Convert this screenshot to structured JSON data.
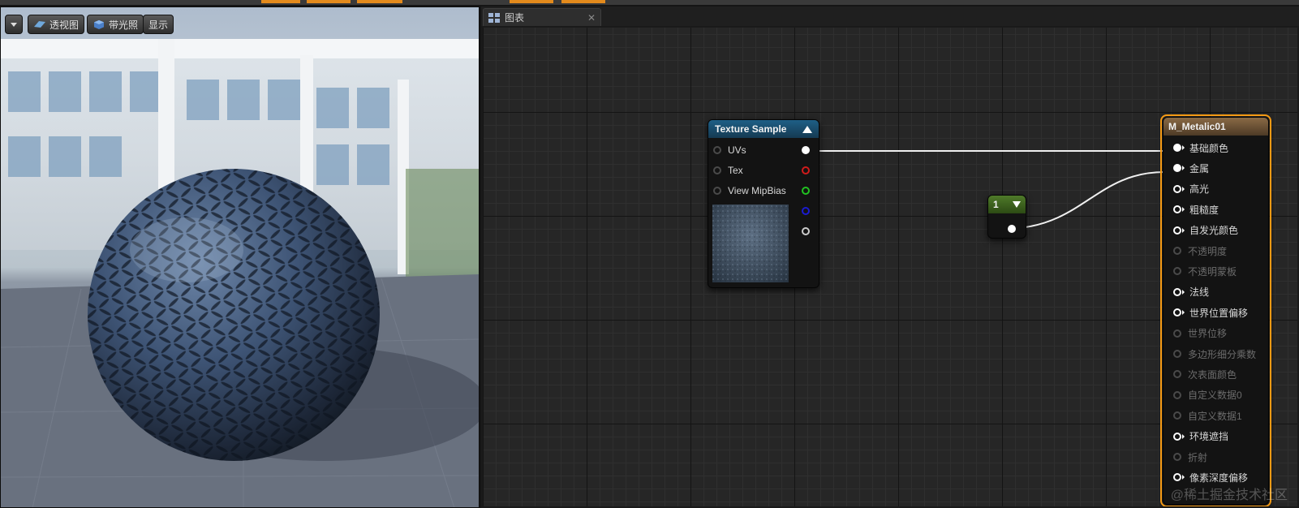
{
  "viewport": {
    "toolbar": {
      "perspective_label": "透视图",
      "lighting_label": "带光照",
      "show_label": "显示"
    }
  },
  "graph": {
    "tab_label": "图表",
    "texture_sample": {
      "title": "Texture Sample",
      "inputs": [
        "UVs",
        "Tex",
        "View MipBias"
      ],
      "output_colors": [
        "#ffffff",
        "#d11b1b",
        "#21c221",
        "#1b1bd1",
        "#cccccc"
      ]
    },
    "constant": {
      "value": "1"
    },
    "material": {
      "title": "M_Metalic01",
      "inputs": [
        {
          "label": "基础颜色",
          "state": "connected"
        },
        {
          "label": "金属",
          "state": "connected"
        },
        {
          "label": "高光",
          "state": "active"
        },
        {
          "label": "粗糙度",
          "state": "active"
        },
        {
          "label": "自发光颜色",
          "state": "active"
        },
        {
          "label": "不透明度",
          "state": "disabled"
        },
        {
          "label": "不透明蒙板",
          "state": "disabled"
        },
        {
          "label": "法线",
          "state": "active"
        },
        {
          "label": "世界位置偏移",
          "state": "active"
        },
        {
          "label": "世界位移",
          "state": "disabled"
        },
        {
          "label": "多边形细分乘数",
          "state": "disabled"
        },
        {
          "label": "次表面颜色",
          "state": "disabled"
        },
        {
          "label": "自定义数据0",
          "state": "disabled"
        },
        {
          "label": "自定义数据1",
          "state": "disabled"
        },
        {
          "label": "环境遮挡",
          "state": "active"
        },
        {
          "label": "折射",
          "state": "disabled"
        },
        {
          "label": "像素深度偏移",
          "state": "active"
        }
      ]
    }
  },
  "watermark": "@稀土掘金技术社区",
  "colors": {
    "texture_header": "#1e5f86",
    "constant_header": "#4f7a2a",
    "selection": "#f59a14"
  }
}
